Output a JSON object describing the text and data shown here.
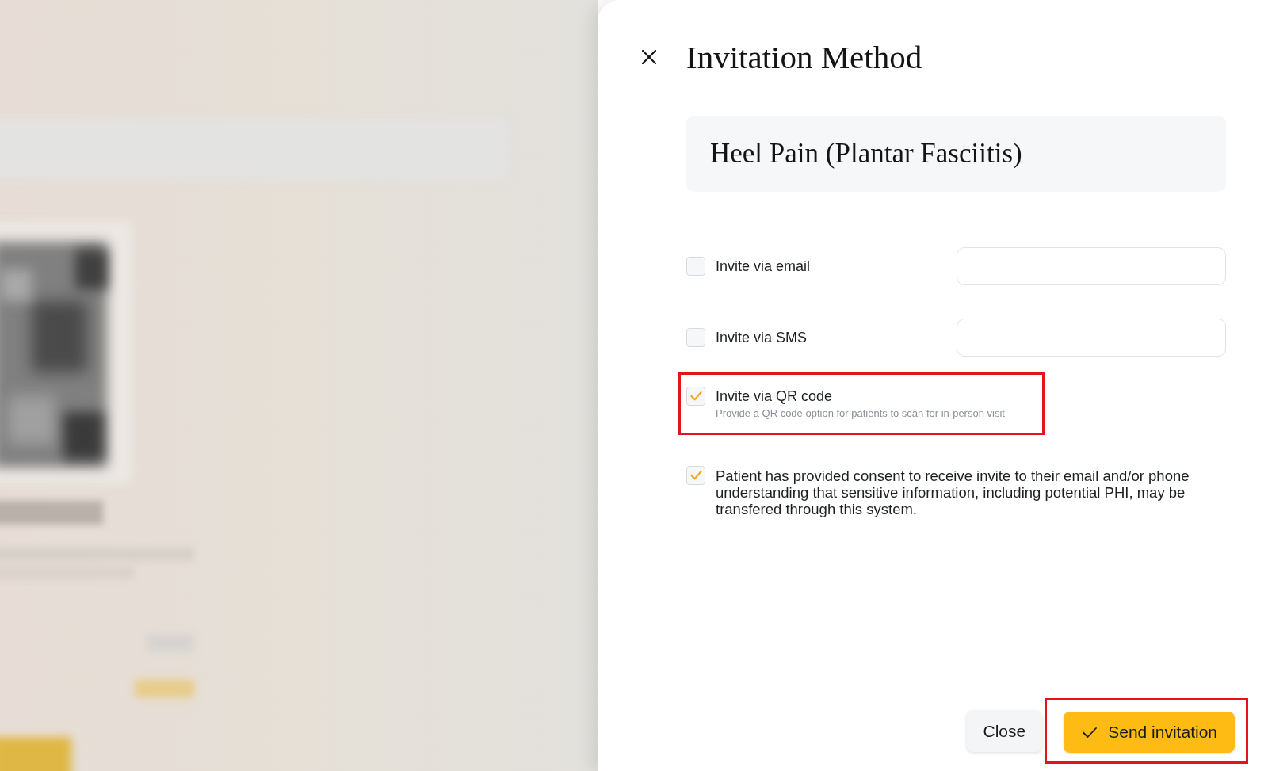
{
  "dialog": {
    "title": "Invitation Method"
  },
  "program": {
    "title": "Heel Pain (Plantar Fasciitis)"
  },
  "options": [
    {
      "kind": "with_input",
      "label": "Invite via email",
      "checked": false,
      "highlighted": false
    },
    {
      "kind": "with_input",
      "label": "Invite via SMS",
      "checked": false,
      "highlighted": false
    },
    {
      "kind": "with_description",
      "label": "Invite via QR code",
      "description": "Provide a QR code option for patients to scan for in-person visit",
      "checked": true,
      "highlighted": true
    }
  ],
  "consent": {
    "text": "Patient has provided consent to receive invite to their email and/or phone understanding that sensitive information, including potential PHI, may be transfered through this system.",
    "checked": true
  },
  "buttons": [
    {
      "kind": "secondary",
      "label": "Close",
      "highlighted": false
    },
    {
      "kind": "primary",
      "label": "Send invitation",
      "highlighted": true
    }
  ]
}
